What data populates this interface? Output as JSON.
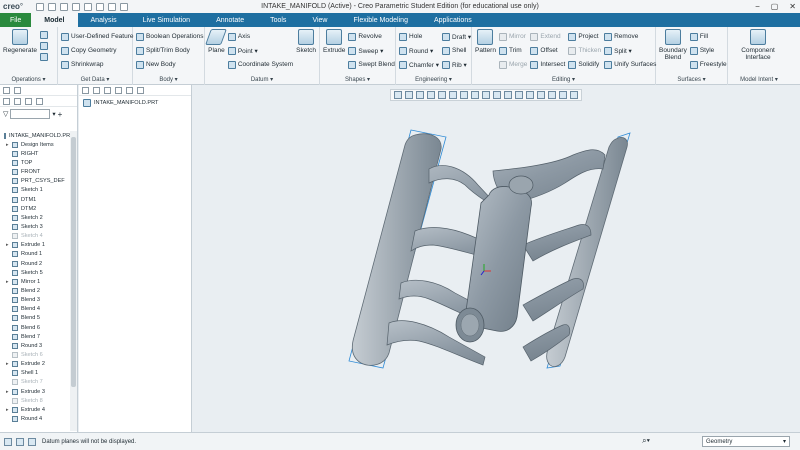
{
  "app": {
    "logo": "creo",
    "window_title": "INTAKE_MANIFOLD (Active) - Creo Parametric Student Edition (for educational use only)"
  },
  "tabs": [
    {
      "label": "File"
    },
    {
      "label": "Model"
    },
    {
      "label": "Analysis"
    },
    {
      "label": "Live Simulation"
    },
    {
      "label": "Annotate"
    },
    {
      "label": "Tools"
    },
    {
      "label": "View"
    },
    {
      "label": "Flexible Modeling"
    },
    {
      "label": "Applications"
    }
  ],
  "ribbon": {
    "operations": {
      "regenerate": "Regenerate",
      "label": "Operations ▾"
    },
    "get_data": {
      "items": [
        "User-Defined Feature",
        "Copy Geometry",
        "Shrinkwrap"
      ],
      "label": "Get Data ▾"
    },
    "body": {
      "items": [
        "Boolean Operations",
        "Split/Trim Body",
        "New Body"
      ],
      "label": "Body ▾"
    },
    "datum": {
      "plane": "Plane",
      "items": [
        "Axis",
        "Point ▾",
        "Coordinate System"
      ],
      "sketch": "Sketch",
      "label": "Datum ▾"
    },
    "shapes": {
      "extrude": "Extrude",
      "items": [
        "Revolve",
        "Sweep ▾",
        "Swept Blend"
      ],
      "label": "Shapes ▾"
    },
    "engineering": {
      "col1": [
        "Hole",
        "Round ▾",
        "Chamfer ▾"
      ],
      "col2": [
        "Draft ▾",
        "Shell",
        "Rib ▾"
      ],
      "label": "Engineering ▾"
    },
    "editing": {
      "pattern": "Pattern",
      "col1": [
        "Mirror",
        "Trim",
        "Merge"
      ],
      "col2": [
        "Extend",
        "Offset",
        "Intersect"
      ],
      "col3": [
        "Project",
        "Thicken",
        "Solidify"
      ],
      "col4": [
        "Remove",
        "Split ▾",
        "Unify Surfaces"
      ],
      "label": "Editing ▾"
    },
    "surfaces": {
      "boundary_blend": "Boundary Blend",
      "items": [
        "Fill",
        "Style",
        "Freestyle"
      ],
      "label": "Surfaces ▾"
    },
    "model_intent": {
      "component_interface": "Component Interface",
      "label": "Model Intent ▾"
    }
  },
  "model_tree": {
    "root": "INTAKE_MANIFOLD.PRT",
    "items": [
      {
        "label": "Design Items",
        "expand": true,
        "suppressed": false
      },
      {
        "label": "RIGHT",
        "expand": false,
        "suppressed": false
      },
      {
        "label": "TOP",
        "expand": false,
        "suppressed": false
      },
      {
        "label": "FRONT",
        "expand": false,
        "suppressed": false
      },
      {
        "label": "PRT_CSYS_DEF",
        "expand": false,
        "suppressed": false
      },
      {
        "label": "Sketch 1",
        "expand": false,
        "suppressed": false
      },
      {
        "label": "DTM1",
        "expand": false,
        "suppressed": false
      },
      {
        "label": "DTM2",
        "expand": false,
        "suppressed": false
      },
      {
        "label": "Sketch 2",
        "expand": false,
        "suppressed": false
      },
      {
        "label": "Sketch 3",
        "expand": false,
        "suppressed": false
      },
      {
        "label": "Sketch 4",
        "expand": false,
        "suppressed": true
      },
      {
        "label": "Extrude 1",
        "expand": true,
        "suppressed": false
      },
      {
        "label": "Round 1",
        "expand": false,
        "suppressed": false
      },
      {
        "label": "Round 2",
        "expand": false,
        "suppressed": false
      },
      {
        "label": "Sketch 5",
        "expand": false,
        "suppressed": false
      },
      {
        "label": "Mirror 1",
        "expand": true,
        "suppressed": false
      },
      {
        "label": "Blend 2",
        "expand": false,
        "suppressed": false
      },
      {
        "label": "Blend 3",
        "expand": false,
        "suppressed": false
      },
      {
        "label": "Blend 4",
        "expand": false,
        "suppressed": false
      },
      {
        "label": "Blend 5",
        "expand": false,
        "suppressed": false
      },
      {
        "label": "Blend 6",
        "expand": false,
        "suppressed": false
      },
      {
        "label": "Blend 7",
        "expand": false,
        "suppressed": false
      },
      {
        "label": "Round 3",
        "expand": false,
        "suppressed": false
      },
      {
        "label": "Sketch 6",
        "expand": false,
        "suppressed": true
      },
      {
        "label": "Extrude 2",
        "expand": true,
        "suppressed": false
      },
      {
        "label": "Shell 1",
        "expand": false,
        "suppressed": false
      },
      {
        "label": "Sketch 7",
        "expand": false,
        "suppressed": true
      },
      {
        "label": "Extrude 3",
        "expand": true,
        "suppressed": false
      },
      {
        "label": "Sketch 8",
        "expand": false,
        "suppressed": true
      },
      {
        "label": "Extrude 4",
        "expand": true,
        "suppressed": false
      },
      {
        "label": "Round 4",
        "expand": false,
        "suppressed": false
      }
    ]
  },
  "layer_panel": {
    "item": "INTAKE_MANIFOLD.PRT"
  },
  "status": {
    "message": "Datum planes will not be displayed.",
    "filter_value": "Geometry"
  },
  "colors": {
    "tab_bar": "#1e6fa1",
    "file_tab": "#2a8a3e",
    "model_body": "#8f9aa4",
    "datum_plane_edge": "#2f8bd6"
  }
}
